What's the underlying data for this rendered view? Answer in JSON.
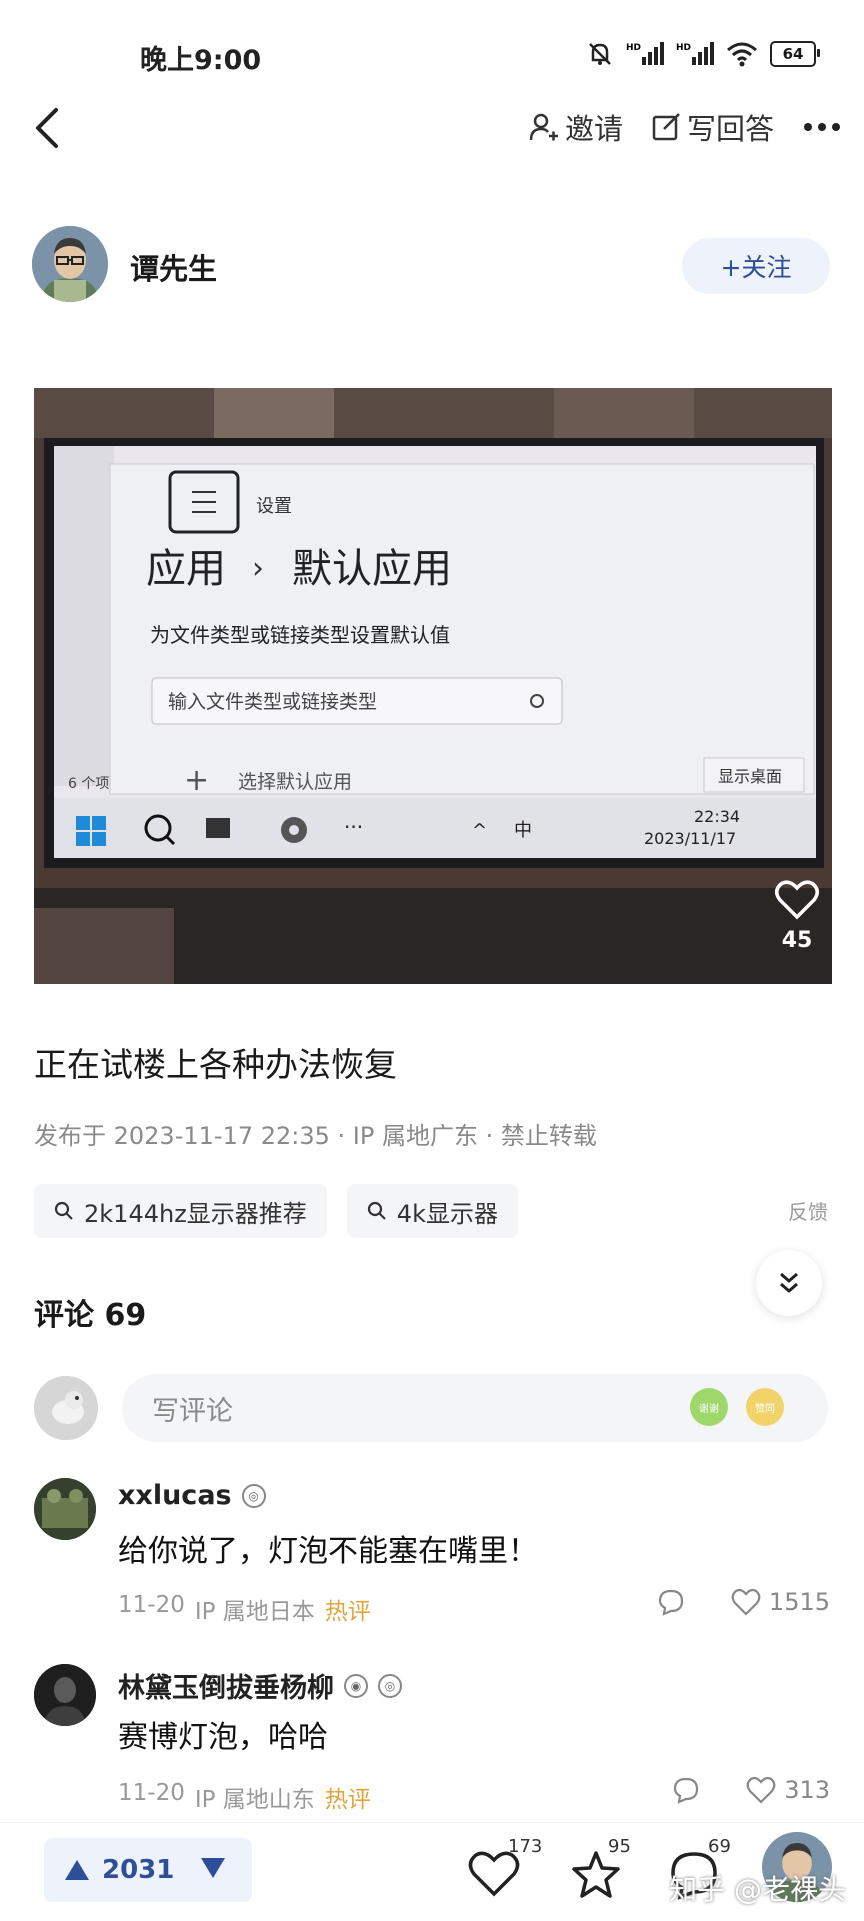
{
  "status_bar": {
    "time": "晚上9:00",
    "battery": "64"
  },
  "nav": {
    "invite_label": "邀请",
    "write_answer_label": "写回答"
  },
  "author": {
    "name": "谭先生",
    "follow_label": "+关注"
  },
  "photo": {
    "settings_title": "设置",
    "breadcrumb_root": "应用",
    "breadcrumb_sep": "›",
    "breadcrumb_leaf": "默认应用",
    "subtitle": "为文件类型或链接类型设置默认值",
    "search_placeholder": "输入文件类型或链接类型",
    "choose_default": "选择默认应用",
    "show_desktop": "显示桌面",
    "taskbar_ime": "中",
    "taskbar_time": "22:34",
    "taskbar_date": "2023/11/17",
    "left_items_count": "6 个项",
    "like_count": "45"
  },
  "post": {
    "caption": "正在试楼上各种办法恢复",
    "meta": "发布于 2023-11-17 22:35 · IP 属地广东 · 禁止转载",
    "chips": [
      "2k144hz显示器推荐",
      "4k显示器"
    ],
    "feedback_label": "反馈"
  },
  "comments": {
    "title": "评论 69",
    "input_placeholder": "写评论",
    "emoji_labels": [
      "谢谢",
      "赞同"
    ],
    "items": [
      {
        "user": "xxlucas",
        "text": "给你说了，灯泡不能塞在嘴里！",
        "date": "11-20",
        "ip": "IP 属地日本",
        "tag": "热评",
        "likes": "1515"
      },
      {
        "user": "林黛玉倒拔垂杨柳",
        "text": "赛博灯泡，哈哈",
        "date": "11-20",
        "ip": "IP 属地山东",
        "tag": "热评",
        "likes": "313"
      }
    ]
  },
  "bottom_bar": {
    "vote_count": "2031",
    "like_count": "173",
    "favorite_count": "95",
    "comment_count": "69",
    "watermark": "知乎 @老裸头"
  },
  "colors": {
    "accent": "#2d4e99",
    "hot_tag": "#e3a43a",
    "chip_bg": "#f4f5f7"
  }
}
